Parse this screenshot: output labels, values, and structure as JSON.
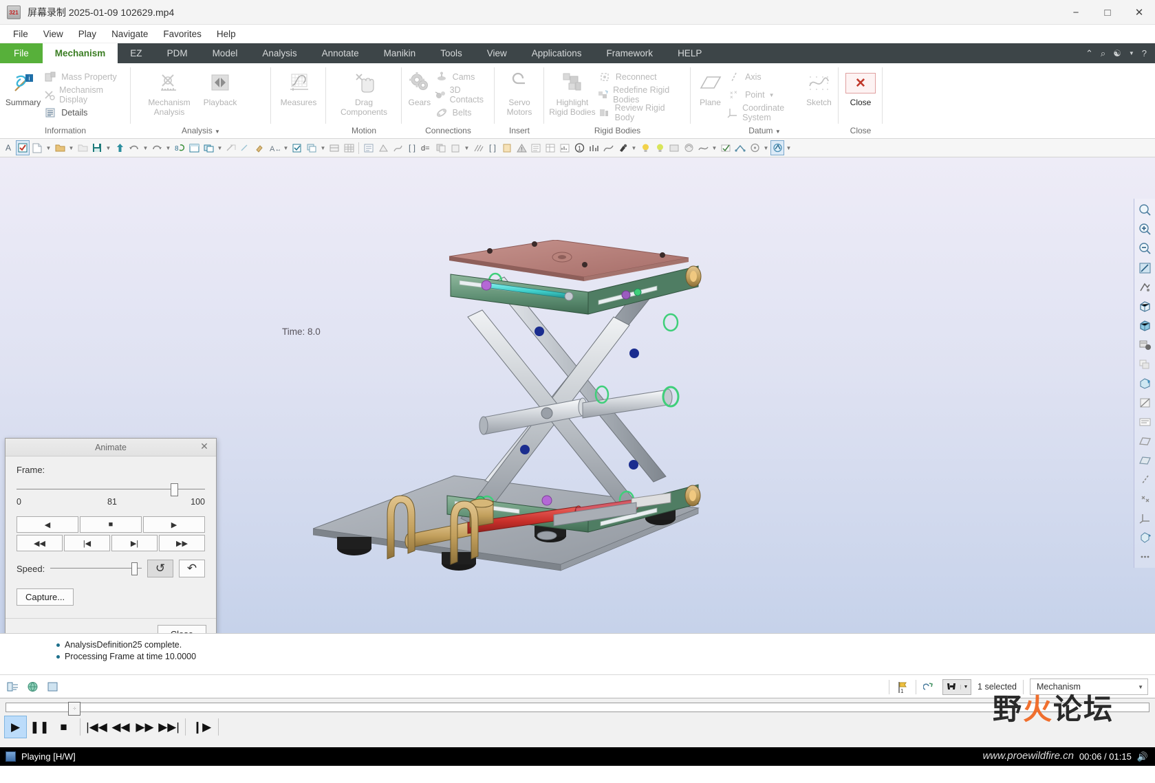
{
  "window": {
    "title": "屏幕录制 2025-01-09 102629.mp4",
    "app_icon": "video-file-icon",
    "minimize": "−",
    "maximize": "□",
    "close": "✕"
  },
  "player_menu": [
    "File",
    "View",
    "Play",
    "Navigate",
    "Favorites",
    "Help"
  ],
  "ribbon": {
    "tabs": [
      {
        "label": "File",
        "kind": "file"
      },
      {
        "label": "Mechanism",
        "kind": "active"
      },
      {
        "label": "EZ",
        "kind": "normal"
      },
      {
        "label": "PDM",
        "kind": "normal"
      },
      {
        "label": "Model",
        "kind": "normal"
      },
      {
        "label": "Analysis",
        "kind": "normal"
      },
      {
        "label": "Annotate",
        "kind": "normal"
      },
      {
        "label": "Manikin",
        "kind": "normal"
      },
      {
        "label": "Tools",
        "kind": "normal"
      },
      {
        "label": "View",
        "kind": "normal"
      },
      {
        "label": "Applications",
        "kind": "normal"
      },
      {
        "label": "Framework",
        "kind": "normal"
      },
      {
        "label": "HELP",
        "kind": "normal"
      }
    ],
    "tab_tools": [
      "collapse-ribbon",
      "search",
      "account",
      "caret",
      "help"
    ],
    "groups": {
      "information": {
        "name": "Information",
        "summary": "Summary",
        "mass_property": "Mass Property",
        "mechanism_display": "Mechanism Display",
        "details": "Details"
      },
      "analysis": {
        "name": "Analysis",
        "mechanism_analysis": "Mechanism\nAnalysis",
        "mechanism_analysis_l1": "Mechanism",
        "mechanism_analysis_l2": "Analysis",
        "playback": "Playback",
        "measures": "Measures"
      },
      "motion": {
        "name": "Motion",
        "drag_l1": "Drag",
        "drag_l2": "Components"
      },
      "connections": {
        "name": "Connections",
        "gears": "Gears",
        "cams": "Cams",
        "contacts_3d": "3D Contacts",
        "belts": "Belts"
      },
      "insert": {
        "name": "Insert",
        "servo_l1": "Servo",
        "servo_l2": "Motors"
      },
      "rigid_bodies": {
        "name": "Rigid Bodies",
        "highlight_l1": "Highlight",
        "highlight_l2": "Rigid Bodies",
        "reconnect": "Reconnect",
        "redefine": "Redefine Rigid Bodies",
        "review": "Review Rigid Body"
      },
      "datum": {
        "name": "Datum",
        "plane": "Plane",
        "axis": "Axis",
        "point": "Point",
        "coordinate_system": "Coordinate System",
        "sketch": "Sketch"
      },
      "close": {
        "name": "Close",
        "close_label": "Close"
      }
    }
  },
  "graphics": {
    "time_label": "Time: 8.0",
    "background_top": "#eeecf7",
    "background_bottom": "#c6d2ea",
    "vertical_toolbar": [
      "zoom-fit-icon",
      "zoom-in-icon",
      "zoom-out-icon",
      "repaint-icon",
      "spin-center-icon",
      "display-style-wireframe-icon",
      "display-style-shaded-icon",
      "perspective-view-icon",
      "saved-views-icon",
      "layers-icon",
      "appearance-icon",
      "section-icon",
      "annotation-display-icon",
      "datum-display-icon",
      "plane-display-icon",
      "axis-display-icon",
      "point-display-icon",
      "csys-display-icon",
      "spin-icon",
      "more-icon"
    ]
  },
  "animate_dialog": {
    "title": "Animate",
    "close_icon": "✕",
    "frame_label": "Frame:",
    "frame_min": "0",
    "frame_current": "81",
    "frame_max": "100",
    "slider_percent": 81,
    "transport_row1": [
      "◀",
      "■",
      "▶"
    ],
    "transport_row2": [
      "◀◀",
      "|◀",
      "▶|",
      "▶▶"
    ],
    "speed_label": "Speed:",
    "speed_percent": 95,
    "repeat_icon": "↺",
    "reverse_icon": "↶",
    "capture_label": "Capture...",
    "close_label": "Close"
  },
  "messages": [
    "AnalysisDefinition25 complete.",
    "Processing Frame at time 10.0000"
  ],
  "status_bar": {
    "left_icons": [
      "model-tree-icon",
      "globe-icon",
      "window-icon"
    ],
    "flag_icon": "flag-1-icon",
    "filter_icon": "selection-filter-icon",
    "search_icon": "find-icon",
    "selection_text": "1 selected",
    "mode_value": "Mechanism"
  },
  "media_player": {
    "controls": [
      "play",
      "pause",
      "stop",
      "skip-back",
      "rewind",
      "fast-forward",
      "skip-forward",
      "step-frame"
    ],
    "play_glyph": "▶",
    "pause_glyph": "❚❚",
    "stop_glyph": "■",
    "prev_glyph": "|◀◀",
    "rew_glyph": "◀◀",
    "ff_glyph": "▶▶",
    "next_glyph": "▶▶|",
    "step_glyph": "❙▶",
    "seek_percent": 8,
    "status_text": "Playing [H/W]",
    "time_display": "00:06 / 01:15"
  },
  "watermark": {
    "text_1": "野",
    "text_fire": "火",
    "text_2": "论坛",
    "url": "www.proewildfire.cn"
  }
}
